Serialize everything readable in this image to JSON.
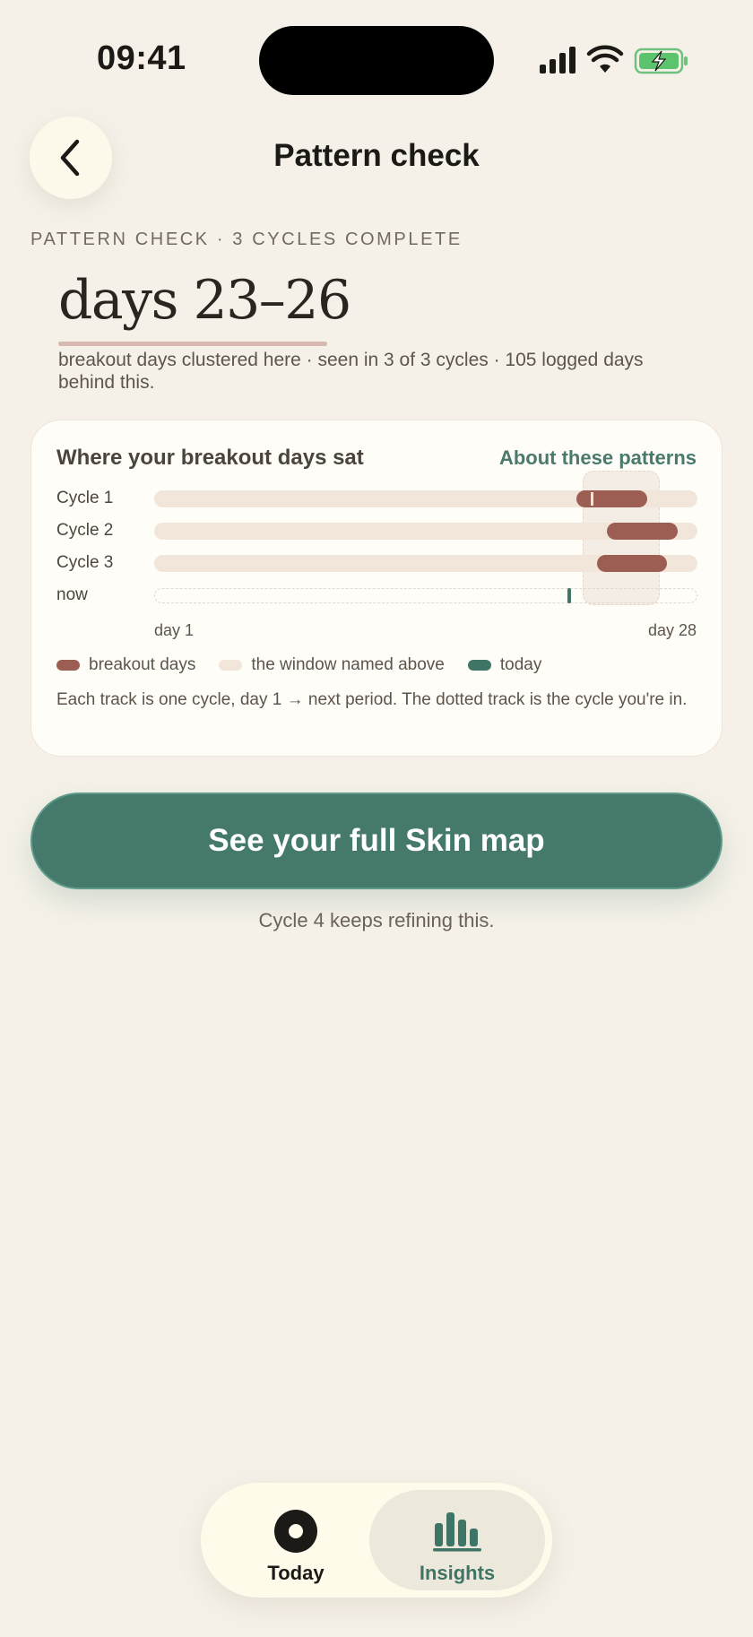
{
  "status_bar": {
    "time": "09:41"
  },
  "header": {
    "title": "Pattern check"
  },
  "summary": {
    "eyebrow": "PATTERN CHECK · 3 CYCLES COMPLETE",
    "headline": "days 23–26",
    "subline": "breakout days clustered here · seen in 3 of 3 cycles · 105 logged days behind this."
  },
  "card": {
    "title": "Where your breakout days sat",
    "link": "About these patterns",
    "rows": [
      {
        "label": "Cycle 1"
      },
      {
        "label": "Cycle 2"
      },
      {
        "label": "Cycle 3"
      },
      {
        "label": "now"
      }
    ],
    "axis_start": "day 1",
    "axis_end": "day 28",
    "legend": [
      {
        "label": "breakout days",
        "color": "#9c5e52"
      },
      {
        "label": "the window named above",
        "color": "#f2e6da"
      },
      {
        "label": "today",
        "color": "#3f7566"
      }
    ],
    "note": "Each track is one cycle, day 1 → next period. The dotted track is the cycle you're in."
  },
  "chart_data": {
    "type": "bar",
    "x_range": [
      1,
      28
    ],
    "highlight_window": [
      23,
      26
    ],
    "series": [
      {
        "name": "Cycle 1",
        "breakout_start": 22,
        "breakout_end": 25.5
      },
      {
        "name": "Cycle 2",
        "breakout_start": 23.5,
        "breakout_end": 27
      },
      {
        "name": "Cycle 3",
        "breakout_start": 23,
        "breakout_end": 26.5
      }
    ],
    "today_day": 21.5
  },
  "cta": {
    "label": "See your full Skin map",
    "note": "Cycle 4 keeps refining this."
  },
  "nav": {
    "items": [
      {
        "label": "Today",
        "active": false
      },
      {
        "label": "Insights",
        "active": true
      }
    ],
    "accent": "#3f7566"
  }
}
